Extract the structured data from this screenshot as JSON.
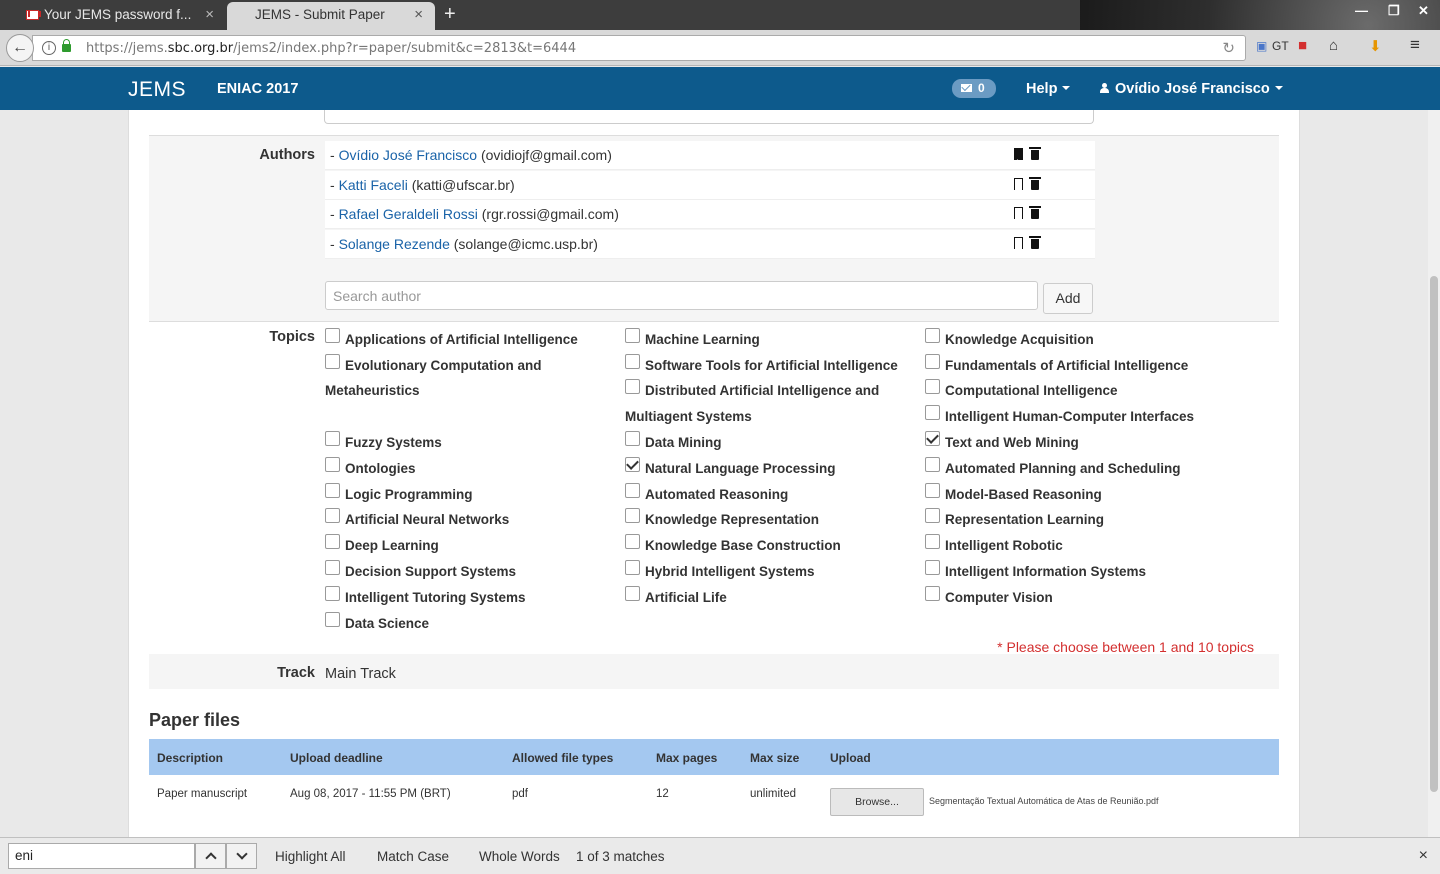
{
  "browser": {
    "tabs": [
      {
        "title": "Your JEMS password f...",
        "close": "×"
      },
      {
        "title": "JEMS - Submit Paper",
        "close": "×"
      }
    ],
    "new_tab": "+",
    "url_prefix": "https://jems.",
    "url_domain": "sbc.org.br",
    "url_path": "/jems2/index.php?r=paper/submit&c=2813&t=6444",
    "gt_label": "GT"
  },
  "app": {
    "brand": "JEMS",
    "conference": "ENIAC 2017",
    "messages_count": "0",
    "help": "Help",
    "user": "Ovídio José Francisco"
  },
  "authors": {
    "label": "Authors",
    "list": [
      {
        "name": "Ovídio José Francisco",
        "email": "(ovidiojf@gmail.com)",
        "contact": true
      },
      {
        "name": "Katti Faceli",
        "email": "(katti@ufscar.br)",
        "contact": false
      },
      {
        "name": "Rafael Geraldeli Rossi",
        "email": "(rgr.rossi@gmail.com)",
        "contact": false
      },
      {
        "name": "Solange Rezende",
        "email": "(solange@icmc.usp.br)",
        "contact": false
      }
    ],
    "search_placeholder": "Search author",
    "add_label": "Add"
  },
  "topics": {
    "label": "Topics",
    "col1": [
      {
        "label": "Applications of Artificial Intelligence",
        "checked": false
      },
      {
        "label": "Evolutionary Computation and",
        "label2": "Metaheuristics",
        "checked": false
      },
      {
        "label": "Fuzzy Systems",
        "checked": false
      },
      {
        "label": "Ontologies",
        "checked": false
      },
      {
        "label": "Logic Programming",
        "checked": false
      },
      {
        "label": "Artificial Neural Networks",
        "checked": false
      },
      {
        "label": "Deep Learning",
        "checked": false
      },
      {
        "label": "Decision Support Systems",
        "checked": false
      },
      {
        "label": "Intelligent Tutoring Systems",
        "checked": false
      },
      {
        "label": "Data Science",
        "checked": false
      }
    ],
    "col2": [
      {
        "label": "Machine Learning",
        "checked": false
      },
      {
        "label": "Software Tools for Artificial Intelligence",
        "checked": false
      },
      {
        "label": "Distributed Artificial Intelligence and",
        "label2": "Multiagent Systems",
        "checked": false
      },
      {
        "label": "Data Mining",
        "checked": false
      },
      {
        "label": "Natural Language Processing",
        "checked": true
      },
      {
        "label": "Automated Reasoning",
        "checked": false
      },
      {
        "label": "Knowledge Representation",
        "checked": false
      },
      {
        "label": "Knowledge Base Construction",
        "checked": false
      },
      {
        "label": "Hybrid Intelligent Systems",
        "checked": false
      },
      {
        "label": "Artificial Life",
        "checked": false
      }
    ],
    "col3": [
      {
        "label": "Knowledge Acquisition",
        "checked": false
      },
      {
        "label": "Fundamentals of Artificial Intelligence",
        "checked": false
      },
      {
        "label": "Computational Intelligence",
        "checked": false
      },
      {
        "label": "Intelligent Human-Computer Interfaces",
        "checked": false
      },
      {
        "label": "Text and Web Mining",
        "checked": true
      },
      {
        "label": "Automated Planning and Scheduling",
        "checked": false
      },
      {
        "label": "Model-Based Reasoning",
        "checked": false
      },
      {
        "label": "Representation Learning",
        "checked": false
      },
      {
        "label": "Intelligent Robotic",
        "checked": false
      },
      {
        "label": "Intelligent Information Systems",
        "checked": false
      },
      {
        "label": "Computer Vision",
        "checked": false
      }
    ],
    "warning": "* Please choose between 1 and 10 topics"
  },
  "track": {
    "label": "Track",
    "value": "Main Track"
  },
  "paper_files": {
    "title": "Paper files",
    "headers": [
      "Description",
      "Upload deadline",
      "Allowed file types",
      "Max pages",
      "Max size",
      "Upload"
    ],
    "row": {
      "description": "Paper manuscript",
      "deadline": "Aug 08, 2017 - 11:55 PM (BRT)",
      "types": "pdf",
      "pages": "12",
      "size": "unlimited",
      "browse": "Browse...",
      "filename": "Segmentação Textual Automática de Atas de Reunião.pdf"
    }
  },
  "findbar": {
    "query": "eni",
    "highlight_all": "Highlight All",
    "match_case": "Match Case",
    "whole_words": "Whole Words",
    "status": "1 of 3 matches",
    "close": "×"
  },
  "colors": {
    "header": "#0d5a8c",
    "table_head": "#a4c8f0",
    "link": "#1a63a8",
    "warning": "#d32f2f"
  }
}
